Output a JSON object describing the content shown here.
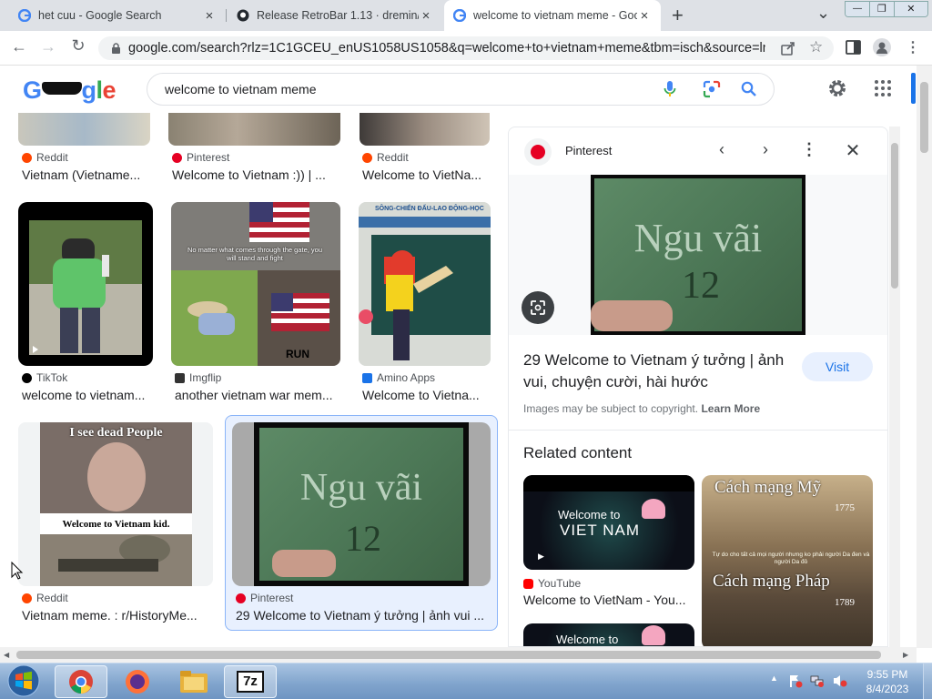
{
  "tabs": [
    {
      "title": "het cuu - Google Search",
      "close": "×"
    },
    {
      "title": "Release RetroBar 1.13 · dremin/Re",
      "close": "×"
    },
    {
      "title": "welcome to vietnam meme - Goo",
      "close": "×"
    }
  ],
  "new_tab": "+",
  "tab_menu": "⌄",
  "window_controls": {
    "minimize": "—",
    "maximize": "❐",
    "close": "✕"
  },
  "toolbar": {
    "back": "←",
    "forward": "→",
    "reload": "↻",
    "url": "google.com/search?rlz=1C1GCEU_enUS1058US1058&q=welcome+to+vietnam+meme&tbm=isch&source=lnm..."
  },
  "google": {
    "logo": "Google",
    "query": "welcome to vietnam meme"
  },
  "results": {
    "row0": [
      {
        "source": "Reddit",
        "title": "Vietnam (Vietname...",
        "icon_color": "#ff4500"
      },
      {
        "source": "Pinterest",
        "title": "Welcome to Vietnam :)) | ...",
        "icon_color": "#e60023"
      },
      {
        "source": "Reddit",
        "title": "Welcome to VietNa...",
        "icon_color": "#ff4500"
      }
    ],
    "row1": [
      {
        "source": "TikTok",
        "title": "welcome to vietnam...",
        "icon_color": "#000000"
      },
      {
        "source": "Imgflip",
        "title": "another vietnam war mem...",
        "icon_color": "#333333"
      },
      {
        "source": "Amino Apps",
        "title": "Welcome to Vietna...",
        "icon_color": "#1a73e8"
      }
    ],
    "row2": [
      {
        "source": "Reddit",
        "title": "Vietnam meme. : r/HistoryMe...",
        "icon_color": "#ff4500"
      },
      {
        "source": "Pinterest",
        "title": "29 Welcome to Vietnam ý tưởng | ảnh vui ...",
        "icon_color": "#e60023"
      }
    ],
    "meme1_text": "No matter what comes through the gate, you will stand and fight",
    "meme1_run": "RUN",
    "meme2_top": "I see dead People",
    "meme2_bottom": "Welcome to Vietnam kid.",
    "book_title": "Ngu vãi",
    "book_number": "12",
    "banner_text": "SÔNG-CHIẾN ĐẤU-LAO ĐỘNG-HỌC"
  },
  "panel": {
    "source": "Pinterest",
    "title": "29 Welcome to Vietnam ý tưởng | ảnh vui, chuyện cười, hài hước",
    "visit": "Visit",
    "copyright": "Images may be subject to copyright.",
    "learn_more": "Learn More",
    "related_heading": "Related content",
    "related": [
      {
        "source": "YouTube",
        "title": "Welcome to VietNam - You...",
        "thumb_line1": "Welcome to",
        "thumb_line2": "VIET NAM"
      },
      {
        "thumb_top": "Cách mạng Mỹ",
        "thumb_year1": "1775",
        "thumb_note": "Tự do cho tất cả mọi người nhưng ko phải người Da đen và người Da đỏ",
        "thumb_mid": "Cách mạng Pháp",
        "thumb_year2": "1789"
      }
    ],
    "related_partial": "Welcome to"
  },
  "taskbar": {
    "time": "9:55 PM",
    "date": "8/4/2023",
    "seven_zip": "7z",
    "tray_arrow": "▲"
  }
}
